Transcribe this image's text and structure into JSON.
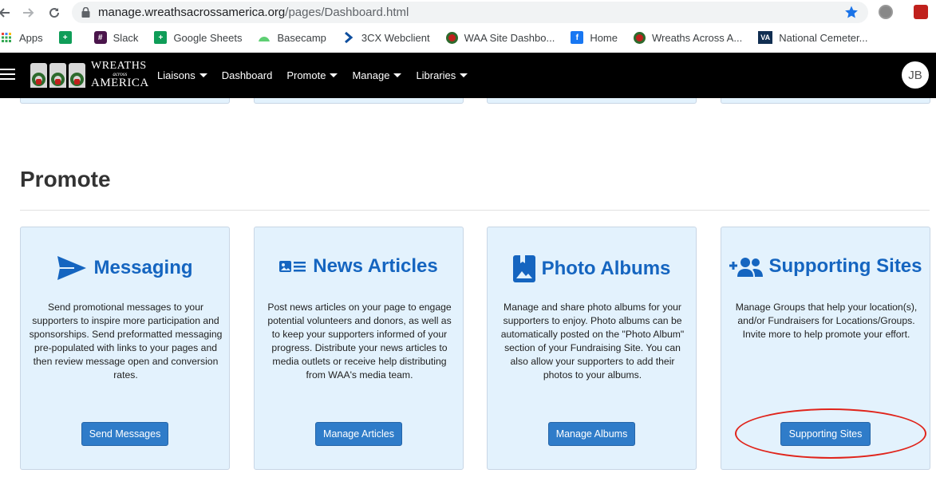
{
  "browser": {
    "url_host": "manage.wreathsacrossamerica.org",
    "url_path": "/pages/Dashboard.html",
    "bookmarks": [
      {
        "label": "Apps",
        "icon": "apps-grid-icon"
      },
      {
        "label": "",
        "icon": "green-plus-icon"
      },
      {
        "label": "Slack",
        "icon": "slack-icon"
      },
      {
        "label": "Google Sheets",
        "icon": "google-sheets-icon"
      },
      {
        "label": "Basecamp",
        "icon": "basecamp-icon"
      },
      {
        "label": "3CX Webclient",
        "icon": "3cx-icon"
      },
      {
        "label": "WAA Site Dashbo...",
        "icon": "waa-wreath-icon"
      },
      {
        "label": "Home",
        "icon": "facebook-icon"
      },
      {
        "label": "Wreaths Across A...",
        "icon": "waa-wreath-icon"
      },
      {
        "label": "National Cemeter...",
        "icon": "va-icon"
      }
    ]
  },
  "header": {
    "logo_line1": "WREATHS",
    "logo_line2": "across",
    "logo_line3": "AMERICA",
    "menu": [
      {
        "label": "Liaisons",
        "dropdown": true
      },
      {
        "label": "Dashboard",
        "dropdown": false
      },
      {
        "label": "Promote",
        "dropdown": true
      },
      {
        "label": "Manage",
        "dropdown": true
      },
      {
        "label": "Libraries",
        "dropdown": true
      }
    ],
    "avatar_initials": "JB"
  },
  "section": {
    "title": "Promote"
  },
  "cards": [
    {
      "title": "Messaging",
      "icon": "send-paper-plane-icon",
      "description": "Send promotional messages to your supporters to inspire more participation and sponsorships. Send preformatted messaging pre-populated with links to your pages and then review message open and conversion rates.",
      "button": "Send Messages"
    },
    {
      "title": "News Articles",
      "icon": "news-article-icon",
      "description": "Post news articles on your page to engage potential volunteers and donors, as well as to keep your supporters informed of your progress. Distribute your news articles to media outlets or receive help distributing from WAA's media team.",
      "button": "Manage Articles"
    },
    {
      "title": "Photo Albums",
      "icon": "photo-album-icon",
      "description": "Manage and share photo albums for your supporters to enjoy. Photo albums can be automatically posted on the \"Photo Album\" section of your Fundraising Site. You can also allow your supporters to add their photos to your albums.",
      "button": "Manage Albums"
    },
    {
      "title": "Supporting Sites",
      "icon": "add-group-icon",
      "description": "Manage Groups that help your location(s), and/or Fundraisers for Locations/Groups. Invite more to help promote your effort.",
      "button": "Supporting Sites"
    }
  ],
  "colors": {
    "accent": "#1565c0",
    "button": "#2f7cc9",
    "card_bg": "#e3f2fd",
    "header_bg": "#000000",
    "highlight": "#e0241b"
  }
}
